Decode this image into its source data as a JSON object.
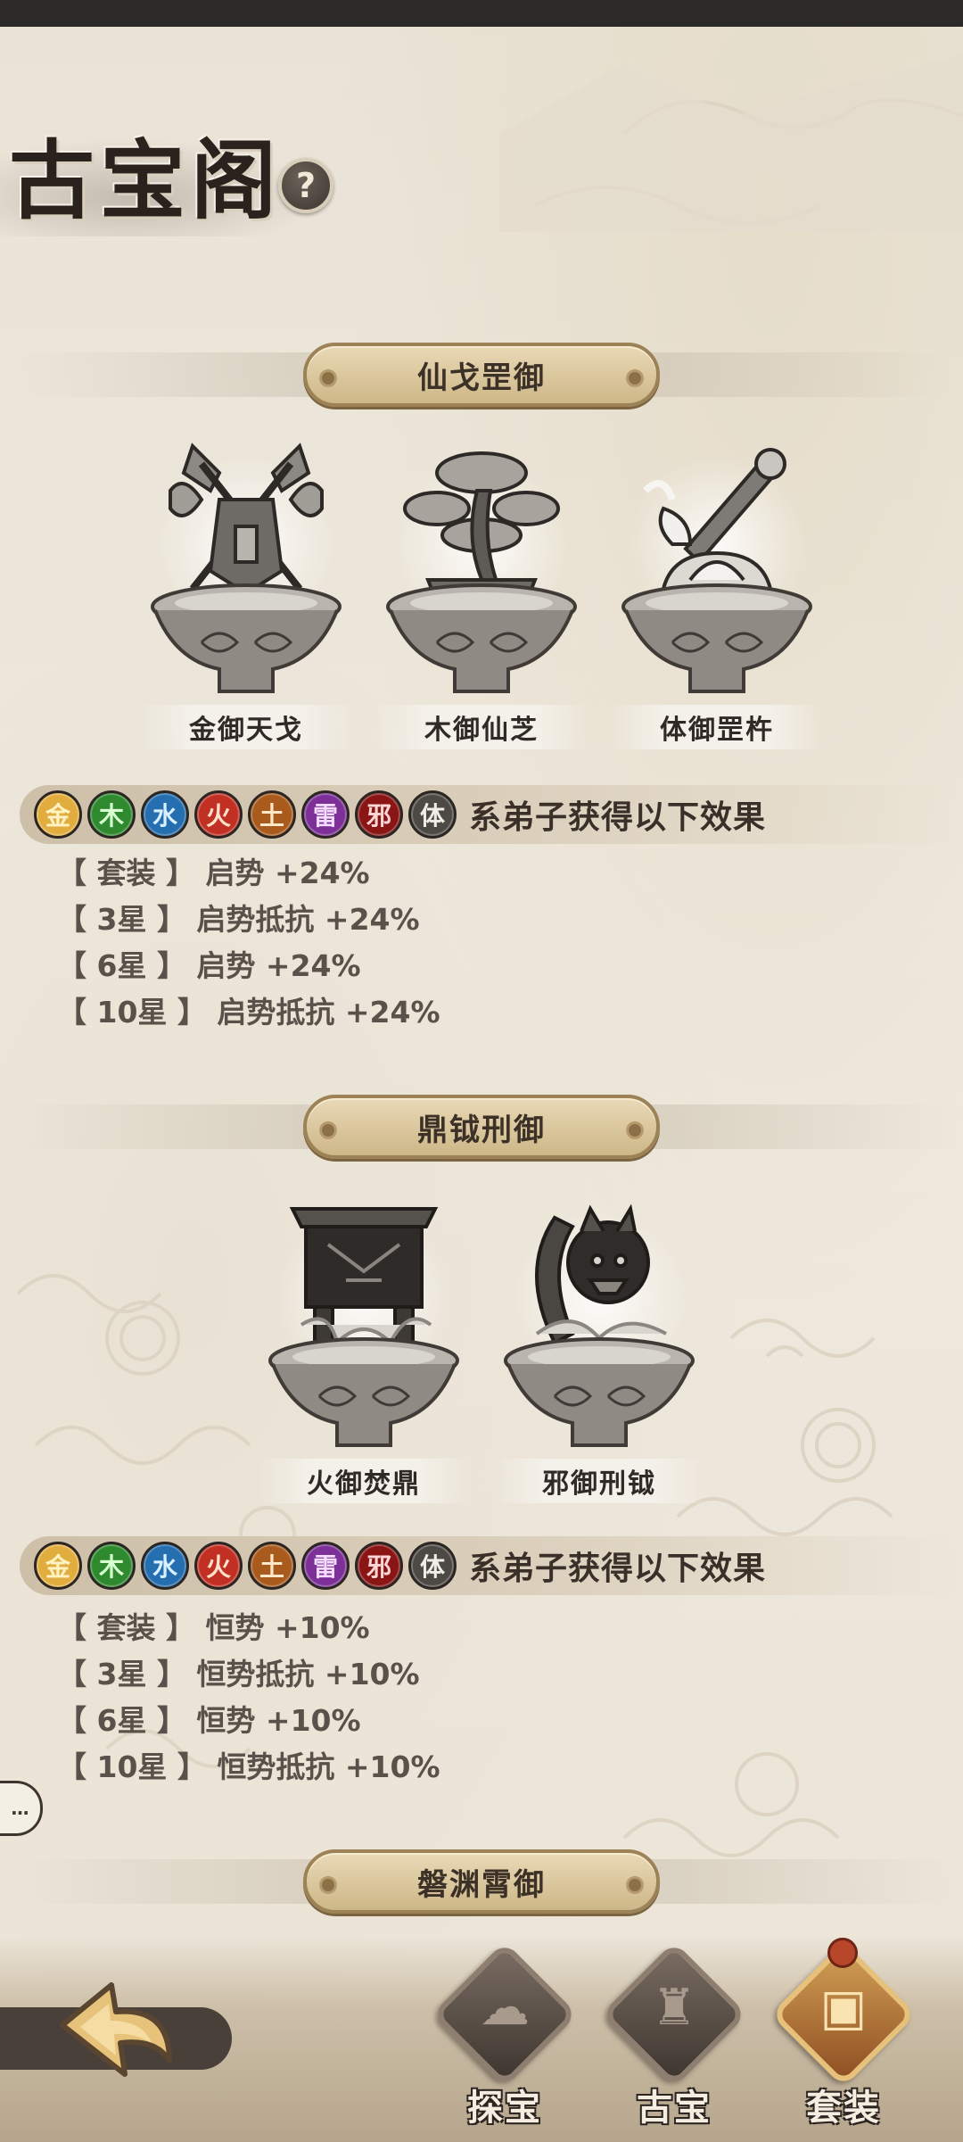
{
  "title": "古宝阁",
  "help_label": "?",
  "colors": {
    "gold": "#d9a43a",
    "wood": "#3f9a3a",
    "water": "#2f86c9",
    "fire": "#cc3a2a",
    "earth": "#b9692a",
    "thunder": "#8a3ea8",
    "evil": "#8e1a1a",
    "body": "#55504b"
  },
  "elements": [
    {
      "label": "金",
      "color": "#e2ad3f",
      "text": "#fff3c4"
    },
    {
      "label": "木",
      "color": "#2f8a2f",
      "text": "#d8ffcf"
    },
    {
      "label": "水",
      "color": "#256eb0",
      "text": "#d8f0ff"
    },
    {
      "label": "火",
      "color": "#c23024",
      "text": "#ffe0c8"
    },
    {
      "label": "土",
      "color": "#a85b1d",
      "text": "#ffe8c8"
    },
    {
      "label": "雷",
      "color": "#7d3198",
      "text": "#f5ddff"
    },
    {
      "label": "邪",
      "color": "#8a1515",
      "text": "#ffd6d6"
    },
    {
      "label": "体",
      "color": "#4d4945",
      "text": "#f0ece6"
    }
  ],
  "sets": [
    {
      "name": "仙戈罡御",
      "items": [
        {
          "name": "金御天戈",
          "icon": "crossed-axes-icon"
        },
        {
          "name": "木御仙芝",
          "icon": "bonsai-mushroom-icon"
        },
        {
          "name": "体御罡杵",
          "icon": "vajra-lotus-icon"
        }
      ],
      "effect_desc": "系弟子获得以下效果",
      "effects": [
        "【 套装 】 启势 +24%",
        "【 3星 】 启势抵抗 +24%",
        "【 6星 】 启势 +24%",
        "【 10星 】 启势抵抗 +24%"
      ]
    },
    {
      "name": "鼎钺刑御",
      "items": [
        {
          "name": "火御焚鼎",
          "icon": "cauldron-icon"
        },
        {
          "name": "邪御刑钺",
          "icon": "demon-axe-icon"
        }
      ],
      "effect_desc": "系弟子获得以下效果",
      "effects": [
        "【 套装 】 恒势 +10%",
        "【 3星 】 恒势抵抗 +10%",
        "【 6星 】 恒势 +10%",
        "【 10星 】 恒势抵抗 +10%"
      ]
    },
    {
      "name": "磐渊霄御"
    }
  ],
  "chat_label": "…",
  "nav": {
    "back_icon": "back-arrow-icon",
    "tabs": [
      {
        "label": "探宝",
        "icon": "treasure-hunt-icon",
        "active": false
      },
      {
        "label": "古宝",
        "icon": "ancient-treasure-icon",
        "active": false
      },
      {
        "label": "套装",
        "icon": "chest-icon",
        "active": true
      }
    ]
  }
}
